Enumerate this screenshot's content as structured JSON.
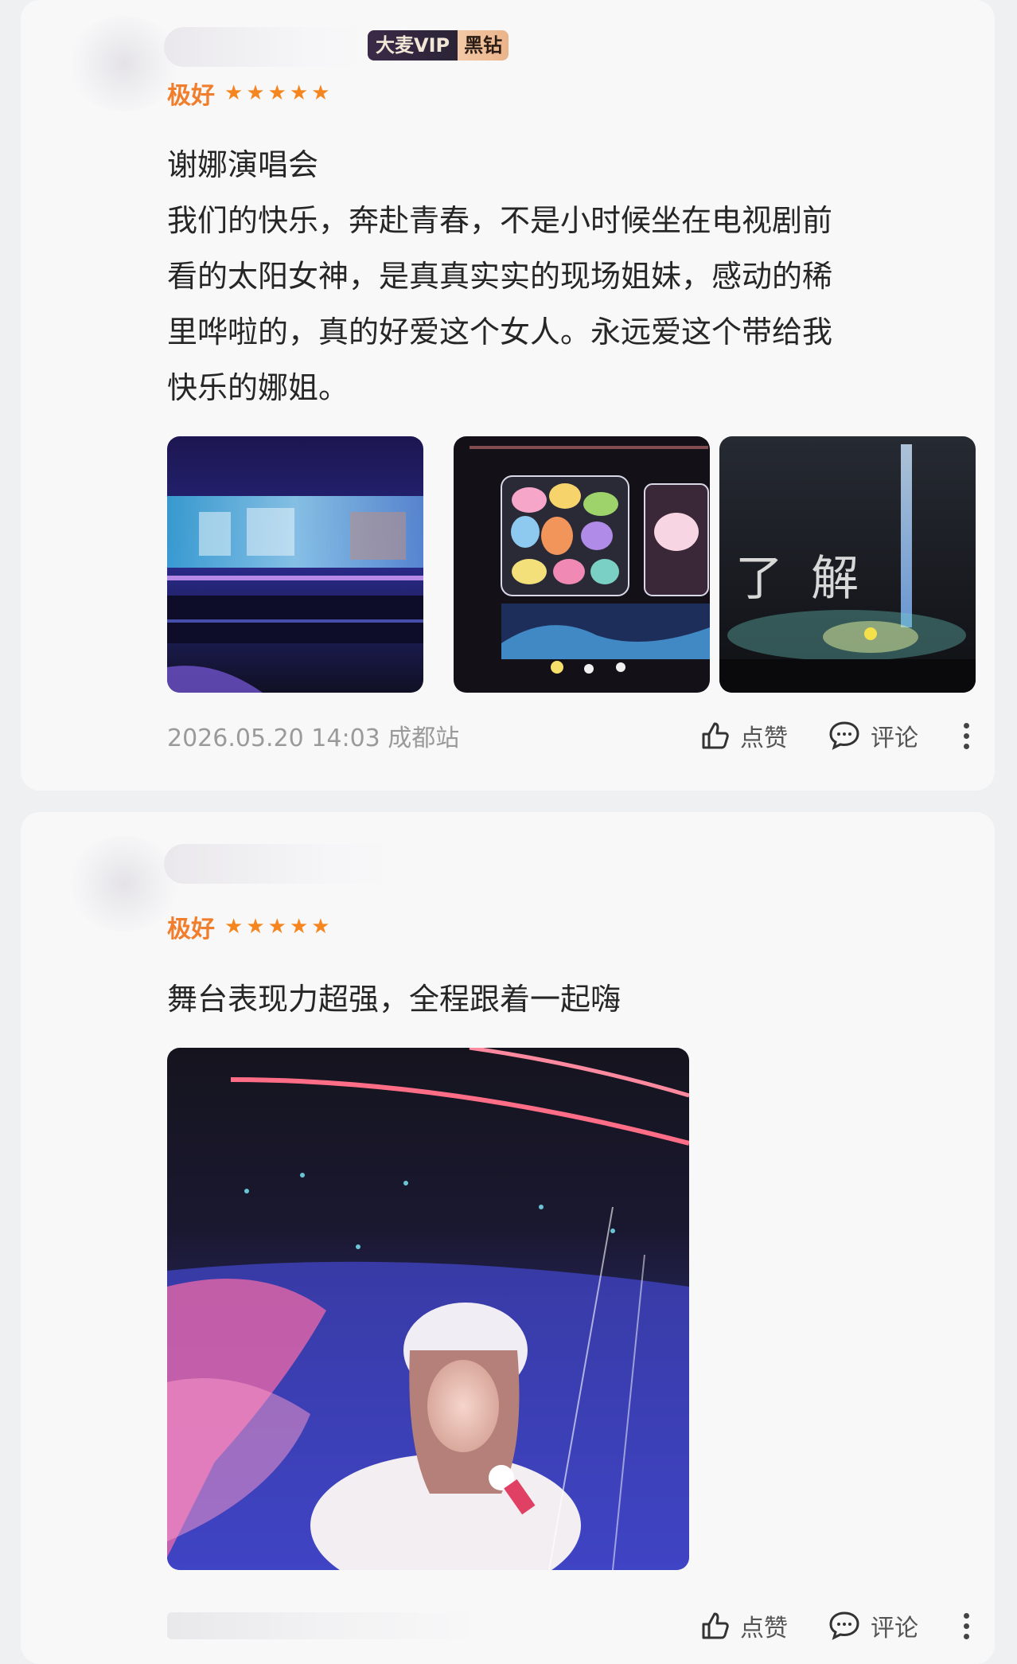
{
  "reviews": [
    {
      "badge": {
        "vip": "大麦VIP",
        "tier": "黑钻"
      },
      "rating_label": "极好",
      "stars": 5,
      "content": "谢娜演唱会\n我们的快乐，奔赴青春，不是小时候坐在电视剧前\n看的太阳女神，是真真实实的现场姐妹，感动的稀\n里哗啦的，真的好爱这个女人。永远爱这个带给我\n快乐的娜姐。",
      "meta": "2026.05.20 14:03 成都站",
      "actions": {
        "like": "点赞",
        "comment": "评论"
      },
      "photos": [
        {
          "icon": "concert-stage-blue-photo"
        },
        {
          "icon": "colorful-plush-stage-photo"
        },
        {
          "icon": "stage-screen-photo",
          "caption": "了  解"
        }
      ]
    },
    {
      "rating_label": "极好",
      "stars": 5,
      "content": "舞台表现力超强，全程跟着一起嗨",
      "meta": "",
      "actions": {
        "like": "点赞",
        "comment": "评论"
      },
      "photos": [
        {
          "icon": "singer-on-stage-photo"
        }
      ]
    }
  ],
  "colors": {
    "accent_orange": "#f07e2c",
    "star": "#f5861f",
    "card_bg": "#f8f8f9",
    "page_bg": "#eef0f2"
  }
}
